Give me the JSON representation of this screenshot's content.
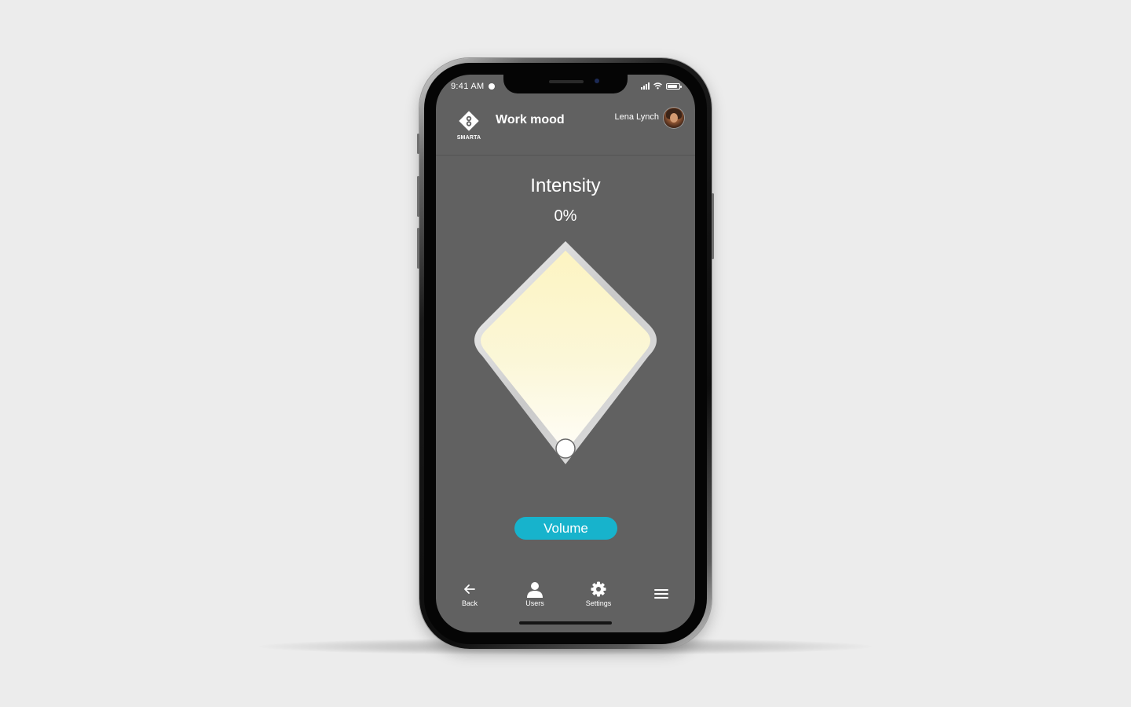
{
  "status_bar": {
    "time": "9:41 AM",
    "icons": [
      "alarm-icon",
      "signal-icon",
      "wifi-icon",
      "battery-icon"
    ]
  },
  "header": {
    "logo_text": "SMARTA",
    "title": "Work mood",
    "user_name": "Lena Lynch"
  },
  "intensity": {
    "title": "Intensity",
    "value": "0%",
    "level": 0
  },
  "volume_button": {
    "label": "Volume",
    "color": "#17b3cc"
  },
  "tabbar": {
    "items": [
      {
        "label": "Back",
        "icon": "arrow-left-icon"
      },
      {
        "label": "Users",
        "icon": "user-icon"
      },
      {
        "label": "Settings",
        "icon": "gear-icon"
      },
      {
        "label": "",
        "icon": "hamburger-menu-icon"
      }
    ]
  },
  "colors": {
    "screen_background": "#616161",
    "page_background": "#ececec",
    "accent": "#17b3cc",
    "light_top": "#fdf4c2",
    "light_bottom": "#fffdf7"
  }
}
